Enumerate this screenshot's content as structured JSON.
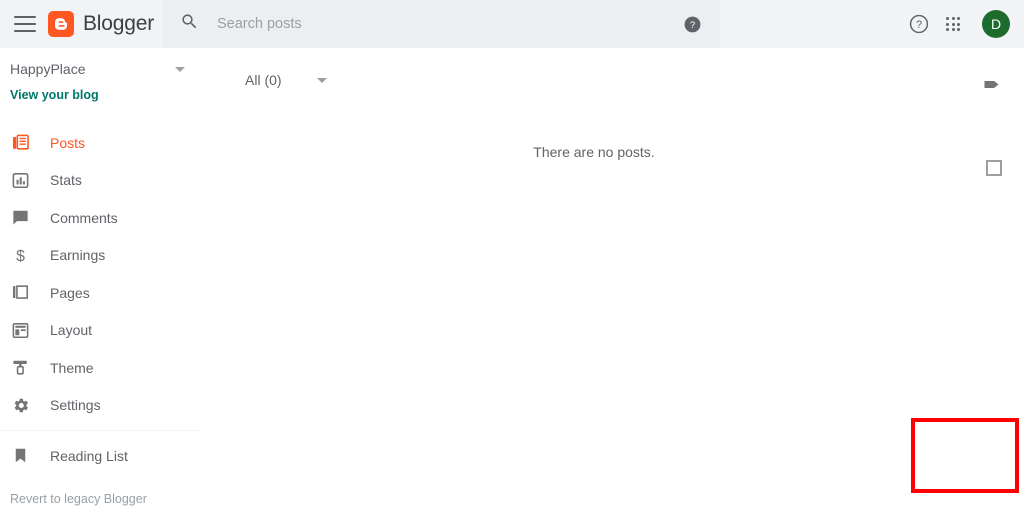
{
  "header": {
    "menu_icon": "hamburger-menu-icon",
    "brand_name": "Blogger",
    "brand_icon": "blogger-logo-icon",
    "search": {
      "icon": "search-icon",
      "placeholder": "Search posts",
      "value": "",
      "help_icon": "help-filled-icon"
    },
    "help_icon": "help-outline-icon",
    "apps_icon": "apps-grid-icon",
    "avatar_letter": "D",
    "avatar_color": "#1e6b2e"
  },
  "sidebar": {
    "blog_name": "HappyPlace",
    "blog_caret_icon": "chevron-down-icon",
    "view_blog_label": "View your blog",
    "view_blog_color": "#00796b",
    "items": [
      {
        "label": "Posts",
        "icon": "posts-icon",
        "active": true
      },
      {
        "label": "Stats",
        "icon": "stats-bar-chart-icon",
        "active": false
      },
      {
        "label": "Comments",
        "icon": "comments-bubble-icon",
        "active": false
      },
      {
        "label": "Earnings",
        "icon": "earnings-dollar-icon",
        "active": false
      },
      {
        "label": "Pages",
        "icon": "pages-layers-icon",
        "active": false
      },
      {
        "label": "Layout",
        "icon": "layout-grid-icon",
        "active": false
      },
      {
        "label": "Theme",
        "icon": "theme-paint-roller-icon",
        "active": false
      },
      {
        "label": "Settings",
        "icon": "settings-gear-icon",
        "active": false
      }
    ],
    "reading_list": {
      "label": "Reading List",
      "icon": "bookmark-icon"
    },
    "legacy_label": "Revert to legacy Blogger",
    "active_color": "#ff5722"
  },
  "main": {
    "filter_label": "All (0)",
    "filter_caret_icon": "chevron-down-icon",
    "label_icon": "label-tag-icon",
    "select_all_checkbox": "select-all-checkbox",
    "empty_message": "There are no posts."
  },
  "fab": {
    "label": "+",
    "icon": "plus-icon",
    "color": "#ff5722"
  },
  "annotation": {
    "color": "#ff0000",
    "target": "new-post-fab"
  }
}
